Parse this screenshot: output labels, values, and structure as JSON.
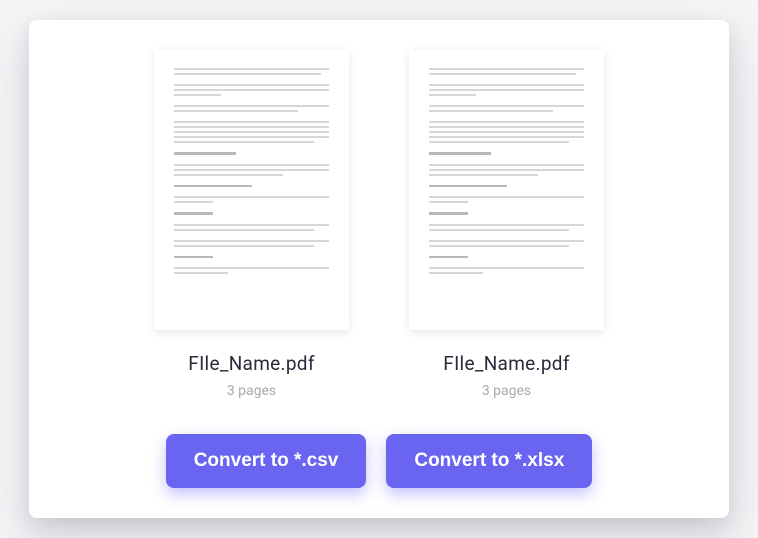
{
  "files": [
    {
      "name": "FIle_Name.pdf",
      "pages_label": "3 pages"
    },
    {
      "name": "FIle_Name.pdf",
      "pages_label": "3 pages"
    }
  ],
  "actions": {
    "convert_csv": "Convert to *.csv",
    "convert_xlsx": "Convert to *.xlsx"
  }
}
